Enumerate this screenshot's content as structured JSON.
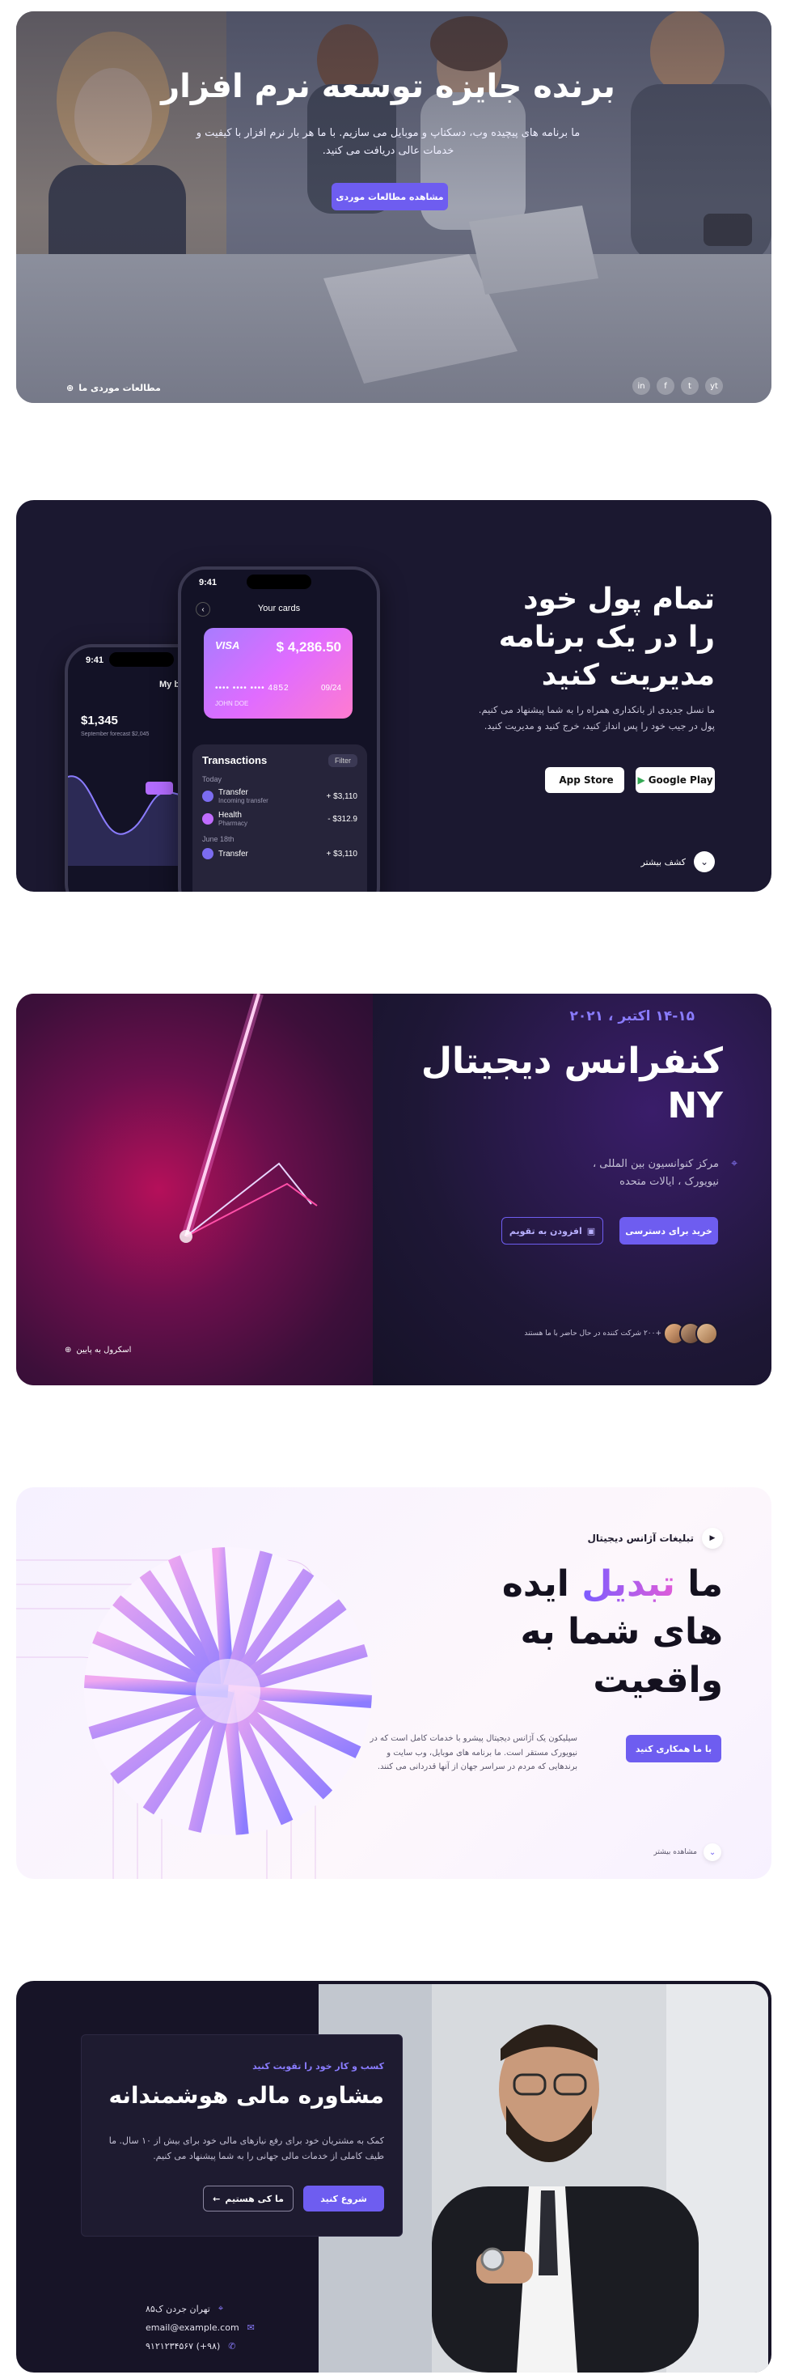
{
  "s1": {
    "title": "برنده جایزه توسعه نرم افزار",
    "subtitle": "ما برنامه های پیچیده وب، دسکتاپ و موبایل می سازیم. با ما هر بار نرم افزار با کیفیت و خدمات عالی دریافت می کنید.",
    "cta": "مشاهده مطالعات موردی",
    "case_link": "مطالعات موردی ما",
    "socials": [
      "in",
      "f",
      "t",
      "yt"
    ]
  },
  "s2": {
    "title": "تمام پول خود را در یک برنامه مدیریت کنید",
    "subtitle": "ما نسل جدیدی از بانکداری همراه را به شما پیشنهاد می کنیم. پول در جیب خود را پس انداز کنید، خرج کنید و مدیریت کنید.",
    "google": "Google Play",
    "apple": "App Store",
    "more": "کشف بیشتر",
    "phone_back": {
      "time": "9:41",
      "title": "My budget",
      "amount": "$1,345",
      "caption": "September forecast $2,045"
    },
    "phone_front": {
      "time": "9:41",
      "title": "Your cards",
      "card": {
        "brand": "VISA",
        "amount": "$ 4,286.50",
        "number": "•••• •••• •••• 4852",
        "expiry": "09/24",
        "holder": "JOHN DOE"
      },
      "tx_title": "Transactions",
      "filter": "Filter",
      "today": "Today",
      "rows": [
        {
          "name": "Transfer",
          "meta": "Incoming transfer",
          "amount": "+ $3,110"
        },
        {
          "name": "Health",
          "meta": "Pharmacy",
          "amount": "- $312.9"
        }
      ],
      "date2": "June 18th",
      "rows2": [
        {
          "name": "Transfer",
          "meta": "",
          "amount": "+ $3,110"
        }
      ]
    }
  },
  "s3": {
    "date": "۱۴-۱۵ اکتبر ، ۲۰۲۱",
    "title": "کنفرانس دیجیتال NY",
    "address": "مرکز کنوانسیون بین المللی ، نیویورک ، ایالات متحده",
    "buy": "خرید برای دسترسی",
    "calendar": "افزودن به تقویم",
    "attendees": "+۲۰۰ شرکت کننده در حال حاضر با ما هستند",
    "scroll": "اسکرول به پایین"
  },
  "s4": {
    "tag": "تبلیغات آژانس دیجیتال",
    "title_a": "ما ",
    "title_hl": "تبدیل",
    "title_b": " ایده های شما به واقعیت",
    "desc": "سیلیکون یک آژانس دیجیتال پیشرو با خدمات کامل است که در نیویورک مستقر است. ما برنامه های موبایل، وب سایت و برندهایی که مردم در سراسر جهان از آنها قدردانی می کنند.",
    "collab": "با ما همکاری کنید",
    "view": "مشاهده بیشتر"
  },
  "s5": {
    "tag": "کسب و کار خود را تقویت کنید",
    "title": "مشاوره مالی هوشمندانه",
    "desc": "کمک به مشتریان خود برای رفع نیازهای مالی خود برای بیش از ۱۰ سال. ما طیف کاملی از خدمات مالی جهانی را به شما پیشنهاد می کنیم.",
    "start": "شروع کنید",
    "who": "ما کی هستیم",
    "address": "تهران جردن ک۸۵",
    "email": "email@example.com",
    "phone": "(۹۸+) ۹۱۲۱۲۳۴۵۶۷"
  }
}
